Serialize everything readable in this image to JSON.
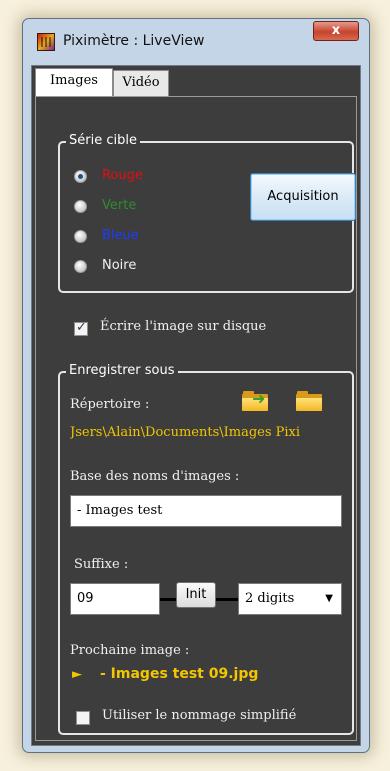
{
  "window": {
    "title": "Piximètre : LiveView",
    "close_glyph": "x"
  },
  "tabs": [
    {
      "label": "Images",
      "selected": true
    },
    {
      "label": "Vidéo",
      "selected": false
    }
  ],
  "serie": {
    "title": "Série cible",
    "options": [
      {
        "label": "Rouge",
        "color": "#e01010",
        "checked": true
      },
      {
        "label": "Verte",
        "color": "#2e8b2e",
        "checked": false
      },
      {
        "label": "Bleue",
        "color": "#1e3cff",
        "checked": false
      },
      {
        "label": "Noire",
        "color": "#f0f0f0",
        "checked": false
      }
    ],
    "acquisition_label": "Acquisition"
  },
  "write_disk": {
    "label": "Écrire l'image sur disque",
    "checked": true
  },
  "save": {
    "title": "Enregistrer sous",
    "directory_label": "Répertoire :",
    "directory_path": "Jsers\\Alain\\Documents\\Images Pixi",
    "base_label": "Base des noms d'images :",
    "base_value": "- Images test",
    "suffix_label": "Suffixe :",
    "suffix_value": "09",
    "init_label": "Init",
    "digits_value": "2 digits",
    "next_label": "Prochaine image :",
    "next_arrow": "►",
    "next_value": "- Images test 09.jpg",
    "simplified_label": "Utiliser le nommage simplifié",
    "simplified_checked": false
  }
}
